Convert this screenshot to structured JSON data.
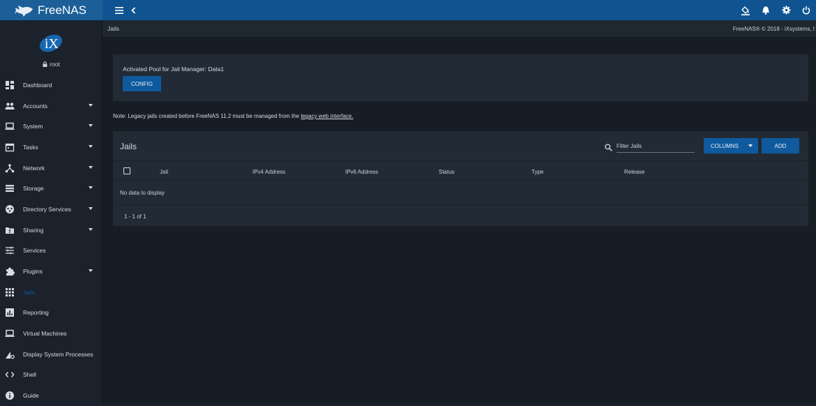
{
  "topbar": {
    "app_name": "FreeNAS",
    "menu_icon": "menu-icon",
    "back_icon": "chevron-left-icon",
    "right_icons": [
      "paint-bucket-icon",
      "bell-icon",
      "gear-icon",
      "power-icon"
    ]
  },
  "sidebar": {
    "user": "root",
    "items": [
      {
        "label": "Dashboard",
        "icon": "dashboard-icon",
        "caret": false
      },
      {
        "label": "Accounts",
        "icon": "people-icon",
        "caret": true
      },
      {
        "label": "System",
        "icon": "laptop-icon",
        "caret": true
      },
      {
        "label": "Tasks",
        "icon": "calendar-icon",
        "caret": true
      },
      {
        "label": "Network",
        "icon": "network-icon",
        "caret": true
      },
      {
        "label": "Storage",
        "icon": "storage-icon",
        "caret": true
      },
      {
        "label": "Directory Services",
        "icon": "directory-icon",
        "caret": true
      },
      {
        "label": "Sharing",
        "icon": "folder-shared-icon",
        "caret": true
      },
      {
        "label": "Services",
        "icon": "tune-icon",
        "caret": false
      },
      {
        "label": "Plugins",
        "icon": "extension-icon",
        "caret": true
      },
      {
        "label": "Jails",
        "icon": "grid-icon",
        "caret": false,
        "active": true
      },
      {
        "label": "Reporting",
        "icon": "chart-icon",
        "caret": false
      },
      {
        "label": "Virtual Machines",
        "icon": "laptop-icon",
        "caret": false
      },
      {
        "label": "Display System Processes",
        "icon": "activity-icon",
        "caret": false
      },
      {
        "label": "Shell",
        "icon": "code-icon",
        "caret": false
      },
      {
        "label": "Guide",
        "icon": "info-icon",
        "caret": false
      }
    ]
  },
  "header": {
    "breadcrumb": "Jails",
    "copyright": "FreeNAS® © 2018 - iXsystems, I"
  },
  "pool": {
    "text": "Activated Pool for Jail Manager: Data1",
    "config_label": "CONFIG"
  },
  "note": {
    "text": "Note: Legacy jails created before FreeNAS 11.2 must be managed from the ",
    "link": "legacy web interface."
  },
  "jails_table": {
    "title": "Jails",
    "filter_placeholder": "Filter Jails",
    "columns_label": "COLUMNS",
    "add_label": "ADD",
    "headers": [
      "Jail",
      "IPv4 Address",
      "IPv6 Address",
      "Status",
      "Type",
      "Release"
    ],
    "empty_text": "No data to display",
    "pagination": "1 - 1 of 1"
  },
  "colors": {
    "topbar": "#0f5390",
    "accent": "#0f5a9e",
    "background": "#171d24",
    "card": "#222b35"
  }
}
